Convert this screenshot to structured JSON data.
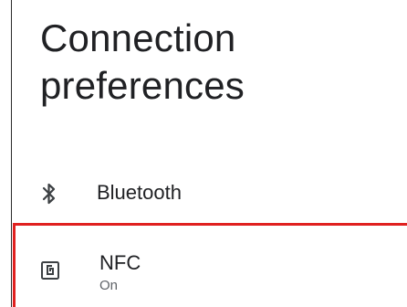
{
  "page": {
    "title": "Connection preferences"
  },
  "items": [
    {
      "label": "Bluetooth",
      "icon": "bluetooth-icon"
    },
    {
      "label": "NFC",
      "summary": "On",
      "icon": "nfc-icon"
    }
  ],
  "colors": {
    "highlight": "#e0201f",
    "text_primary": "#202124",
    "text_secondary": "#5f6368"
  }
}
